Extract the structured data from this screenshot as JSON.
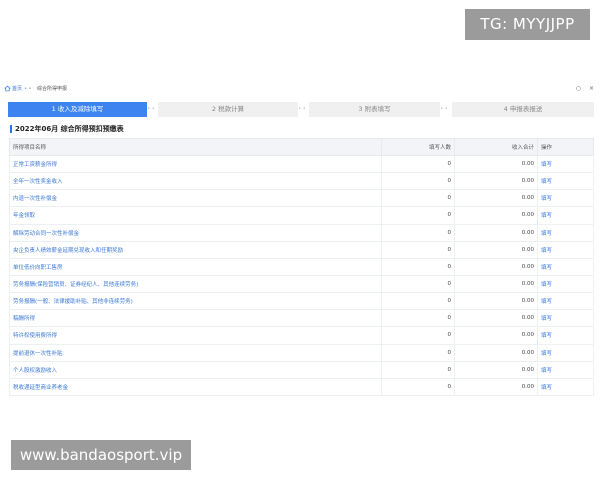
{
  "overlays": {
    "top_right": "TG: MYYJJPP",
    "bottom_left": "www.bandaosport.vip"
  },
  "breadcrumb": {
    "home_icon": "home-icon",
    "home": "首页",
    "separator": "• •",
    "current": "综合所得申报"
  },
  "window_icons": [
    "○",
    "×"
  ],
  "steps": [
    {
      "label": "1 收入及减除填写",
      "active": true
    },
    {
      "label": "2 税款计算",
      "active": false
    },
    {
      "label": "3 附表填写",
      "active": false
    },
    {
      "label": "4 申报表报送",
      "active": false
    }
  ],
  "step_separator": "• •",
  "page_title": "2022年06月 综合所得预扣预缴表",
  "table": {
    "headers": {
      "name": "所得项目名称",
      "count": "填写人数",
      "income": "收入合计",
      "op": "操作"
    },
    "rows": [
      {
        "name": "正常工资薪金所得",
        "count": "0",
        "income": "0.00",
        "op": "填写"
      },
      {
        "name": "全年一次性奖金收入",
        "count": "0",
        "income": "0.00",
        "op": "填写"
      },
      {
        "name": "内退一次性补偿金",
        "count": "0",
        "income": "0.00",
        "op": "填写"
      },
      {
        "name": "年金领取",
        "count": "0",
        "income": "0.00",
        "op": "填写"
      },
      {
        "name": "解除劳动合同一次性补偿金",
        "count": "0",
        "income": "0.00",
        "op": "填写"
      },
      {
        "name": "央企负责人绩效薪金延期兑现收入和任期奖励",
        "count": "0",
        "income": "0.00",
        "op": "填写"
      },
      {
        "name": "单位低价向职工售房",
        "count": "0",
        "income": "0.00",
        "op": "填写"
      },
      {
        "name": "劳务报酬(保险营销员、证券经纪人、其他连续劳务)",
        "count": "0",
        "income": "0.00",
        "op": "填写"
      },
      {
        "name": "劳务报酬(一般、法律援助补贴、其他非连续劳务)",
        "count": "0",
        "income": "0.00",
        "op": "填写"
      },
      {
        "name": "稿酬所得",
        "count": "0",
        "income": "0.00",
        "op": "填写"
      },
      {
        "name": "特许权使用费所得",
        "count": "0",
        "income": "0.00",
        "op": "填写"
      },
      {
        "name": "提前退休一次性补贴",
        "count": "0",
        "income": "0.00",
        "op": "填写"
      },
      {
        "name": "个人股权激励收入",
        "count": "0",
        "income": "0.00",
        "op": "填写"
      },
      {
        "name": "税收递延型商业养老金",
        "count": "0",
        "income": "0.00",
        "op": "填写"
      }
    ]
  },
  "colors": {
    "accent": "#3d84f0",
    "link": "#3a78d6",
    "step_inactive_bg": "#f0f0f0",
    "header_bg": "#f2f4f7"
  }
}
